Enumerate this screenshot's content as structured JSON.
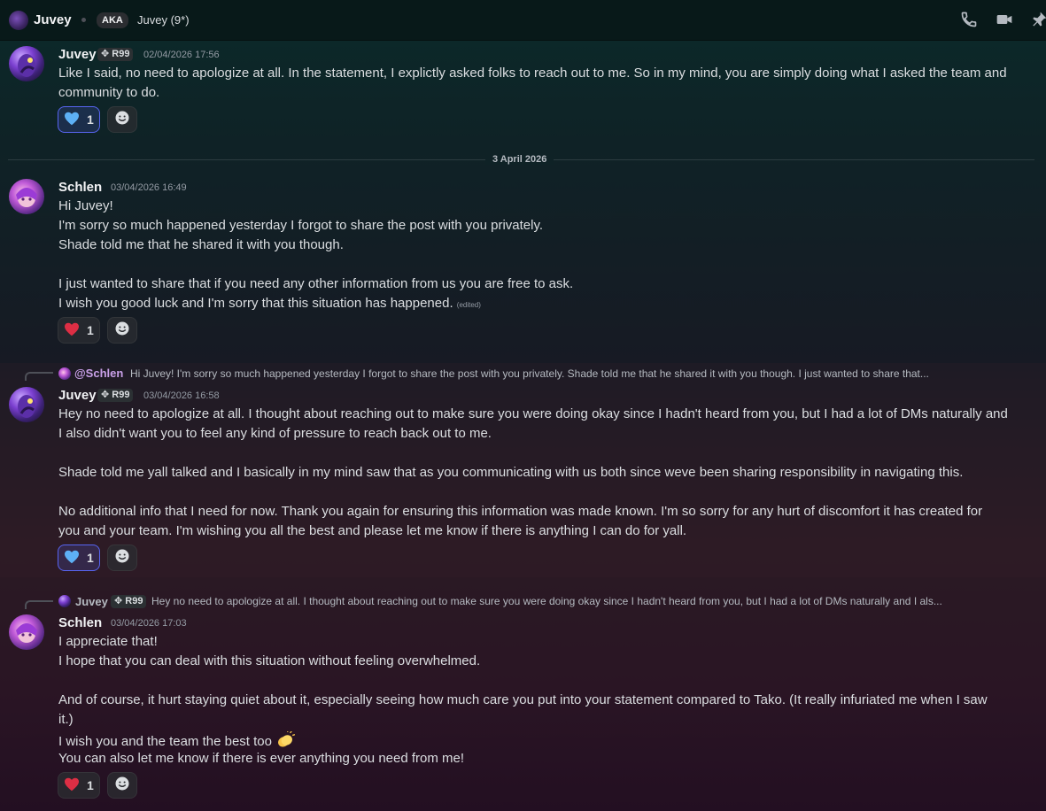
{
  "header": {
    "name": "Juvey",
    "aka_label": "AKA",
    "aka_value": "Juvey (9*)",
    "icons": [
      "phone-icon",
      "video-icon",
      "pin-icon"
    ]
  },
  "date_divider": "3 April 2026",
  "messages": [
    {
      "author": "Juvey",
      "tag": "R99",
      "timestamp": "02/04/2026 17:56",
      "lines": [
        "Like I said, no need to apologize at all. In the statement, I explictly asked folks to reach out to me. So in my mind, you are simply doing what I asked the team and",
        "community to do."
      ],
      "reaction": {
        "emoji": "blue-heart",
        "count": "1",
        "active": true
      }
    },
    {
      "author": "Schlen",
      "timestamp": "03/04/2026 16:49",
      "lines": [
        "Hi Juvey!",
        "I'm sorry so much happened yesterday I forgot to share the post with you privately.",
        "Shade told me that he shared it with you though.",
        "",
        "I just wanted to share that if you need any other information from us you are free to ask.",
        "I wish you good luck and I'm sorry that this situation has happened."
      ],
      "edited": "(edited)",
      "reaction": {
        "emoji": "red-heart",
        "count": "1",
        "active": false
      }
    },
    {
      "reply_to": {
        "mention": "@Schlen",
        "text": "Hi Juvey! I'm sorry so much happened yesterday I forgot to share the post with you privately. Shade told me that he shared it with you though.  I just wanted to share that..."
      },
      "author": "Juvey",
      "tag": "R99",
      "timestamp": "03/04/2026 16:58",
      "lines": [
        "Hey no need to apologize at all. I thought about reaching out to make sure you were doing okay since I hadn't heard from you, but I had a lot of DMs naturally and",
        "I also didn't want you to feel any kind of pressure to reach back out to me.",
        "",
        "Shade told me yall talked and I basically in my mind saw that as you communicating with us both since weve been sharing responsibility in navigating this.",
        "",
        "No additional info that I need for now. Thank you again for ensuring this information was made known. I'm so sorry for any hurt of discomfort it has created for",
        "you and your team. I'm wishing you all the best and please let me know if there is anything I can do for yall."
      ],
      "reaction": {
        "emoji": "blue-heart",
        "count": "1",
        "active": true
      }
    },
    {
      "reply_to": {
        "name": "Juvey",
        "tag": "R99",
        "text": "Hey no need to apologize at all. I thought about reaching out to make sure you were doing okay since I hadn't heard from you, but I had a lot of DMs naturally and I als..."
      },
      "author": "Schlen",
      "timestamp": "03/04/2026 17:03",
      "lines": [
        "I appreciate that!",
        "I hope that you can deal with this situation without feeling overwhelmed.",
        "",
        "And of course, it hurt staying quiet about it, especially seeing how much care you put into your statement compared to Tako. (It really infuriated me when I saw",
        "it.)",
        "I wish you and the team the best too",
        "You can also let me know if there is ever anything you need from me!"
      ],
      "inline_emoji": "clapping-hands",
      "reaction": {
        "emoji": "red-heart",
        "count": "1",
        "active": false
      }
    }
  ]
}
